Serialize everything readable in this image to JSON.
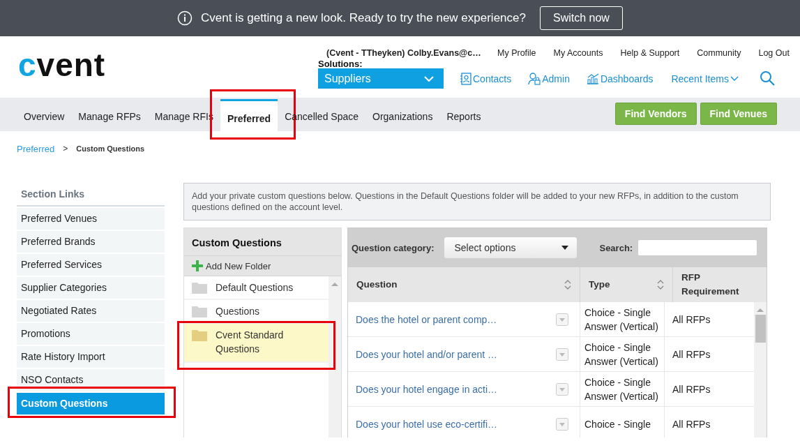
{
  "banner": {
    "message": "Cvent is getting a new look. Ready to try the new experience?",
    "button": "Switch now"
  },
  "header": {
    "logo": "cvent",
    "user": "(Cvent - TTheyken) Colby.Evans@c…",
    "links": [
      "My Profile",
      "My Accounts",
      "Help & Support",
      "Community",
      "Log Out"
    ],
    "solutions_label": "Solutions:",
    "solutions_value": "Suppliers",
    "quick_links": [
      {
        "kind": "contacts",
        "label": "Contacts"
      },
      {
        "kind": "admin",
        "label": "Admin"
      },
      {
        "kind": "dashboards",
        "label": "Dashboards"
      },
      {
        "kind": "recent",
        "label": "Recent Items"
      }
    ]
  },
  "nav": {
    "tabs": [
      {
        "label": "Overview",
        "selected": false,
        "highlighted": false
      },
      {
        "label": "Manage RFPs",
        "selected": false,
        "highlighted": false
      },
      {
        "label": "Manage RFIs",
        "selected": false,
        "highlighted": false
      },
      {
        "label": "Preferred",
        "selected": true,
        "highlighted": true
      },
      {
        "label": "Cancelled Space",
        "selected": false,
        "highlighted": false
      },
      {
        "label": "Organizations",
        "selected": false,
        "highlighted": false
      },
      {
        "label": "Reports",
        "selected": false,
        "highlighted": false
      }
    ],
    "buttons": [
      "Find Vendors",
      "Find Venues"
    ]
  },
  "breadcrumb": [
    {
      "label": "Preferred",
      "kind": "link"
    },
    {
      "label": ">",
      "kind": "separator"
    },
    {
      "label": "Custom Questions",
      "kind": "current"
    }
  ],
  "sidebar": {
    "title": "Section Links",
    "items": [
      {
        "label": "Preferred Venues",
        "selected": false,
        "highlighted": false
      },
      {
        "label": "Preferred Brands",
        "selected": false,
        "highlighted": false
      },
      {
        "label": "Preferred Services",
        "selected": false,
        "highlighted": false
      },
      {
        "label": "Supplier Categories",
        "selected": false,
        "highlighted": false
      },
      {
        "label": "Negotiated Rates",
        "selected": false,
        "highlighted": false
      },
      {
        "label": "Promotions",
        "selected": false,
        "highlighted": false
      },
      {
        "label": "Rate History Import",
        "selected": false,
        "highlighted": false
      },
      {
        "label": "NSO Contacts",
        "selected": false,
        "highlighted": false
      },
      {
        "label": "Custom Questions",
        "selected": true,
        "highlighted": true
      }
    ]
  },
  "info": "Add your private custom questions below. Questions in the Default Questions folder will be added to your new RFPs, in addition to the custom questions defined on the account level.",
  "folders": {
    "title": "Custom Questions",
    "add_label": "Add New Folder",
    "items": [
      {
        "label": "Default Questions",
        "selected": false,
        "highlighted": false
      },
      {
        "label": "Questions",
        "selected": false,
        "highlighted": false
      },
      {
        "label": "Cvent Standard Questions",
        "selected": true,
        "highlighted": true
      }
    ]
  },
  "filters": {
    "category_label": "Question category:",
    "category_placeholder": "Select options",
    "search_label": "Search:"
  },
  "table": {
    "columns": [
      "Question",
      "Type",
      "RFP Requirement"
    ],
    "rows": [
      {
        "question": "Does the hotel or parent comp…",
        "type": "Choice - Single Answer (Vertical)",
        "requirement": "All RFPs"
      },
      {
        "question": "Does your hotel and/or parent …",
        "type": "Choice - Single Answer (Vertical)",
        "requirement": "All RFPs"
      },
      {
        "question": "Does your hotel engage in acti…",
        "type": "Choice - Single Answer (Vertical)",
        "requirement": "All RFPs"
      },
      {
        "question": "Does your hotel use eco-certifi…",
        "type": "Choice - Single",
        "requirement": "All RFPs"
      }
    ]
  }
}
